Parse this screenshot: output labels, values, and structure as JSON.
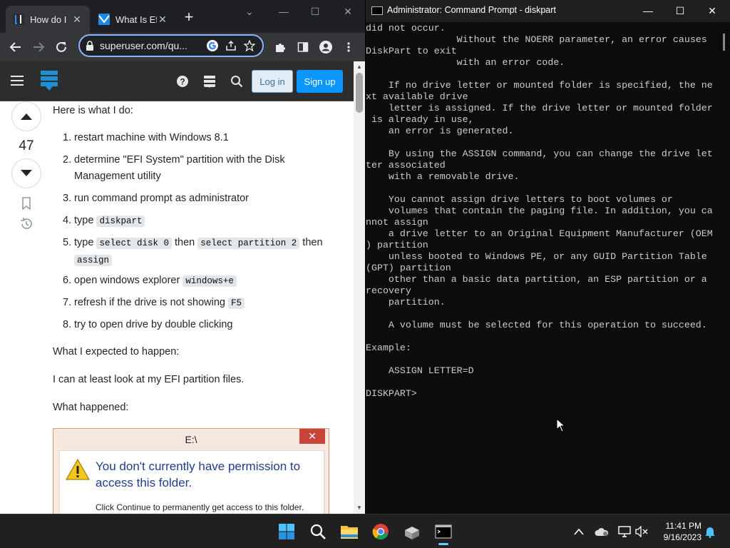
{
  "chrome": {
    "tabs": [
      {
        "title": "How do I",
        "close": "✕"
      },
      {
        "title": "What Is Ef",
        "close": "✕"
      }
    ],
    "new_tab": "+",
    "window_controls": {
      "minimize": "—",
      "maximize": "☐",
      "close": "✕"
    },
    "chevron": "⌄",
    "url": "superuser.com/qu..."
  },
  "site": {
    "login_label": "Log in",
    "signup_label": "Sign up",
    "accent_color": "#0a95ff"
  },
  "post": {
    "votes": "47",
    "intro": "Here is what I do:",
    "steps": [
      {
        "num": "1.",
        "text": "restart machine with Windows 8.1"
      },
      {
        "num": "2.",
        "line1": "determine \"EFI System\" partition with the Disk",
        "line2": "Management utility"
      },
      {
        "num": "3.",
        "text": "run command prompt as administrator"
      },
      {
        "num": "4.",
        "text": "type ",
        "code": "diskpart"
      },
      {
        "num": "5.",
        "text": "type ",
        "code1": "select disk 0",
        "then1": " then ",
        "code2": "select partition 2",
        "then2": " then",
        "code3": "assign"
      },
      {
        "num": "6.",
        "text": "open windows explorer ",
        "code": "windows+e"
      },
      {
        "num": "7.",
        "text": "refresh if the drive is not showing ",
        "code": "F5"
      },
      {
        "num": "8.",
        "text": "try to open drive by double clicking"
      }
    ],
    "expected_heading": "What I expected to happen:",
    "expected_text": "I can at least look at my EFI partition files.",
    "happened_heading": "What happened:",
    "dialog": {
      "title": "E:\\",
      "close": "✕",
      "main_line1": "You don't currently have permission to",
      "main_line2": "access this folder.",
      "sub": "Click Continue to permanently get access to this folder."
    }
  },
  "cmd": {
    "title": "Administrator: Command Prompt - diskpart",
    "window_controls": {
      "minimize": "—",
      "maximize": "☐",
      "close": "✕"
    },
    "lines": [
      "did not occur.",
      "                Without the NOERR parameter, an error causes",
      "DiskPart to exit",
      "                with an error code.",
      "",
      "    If no drive letter or mounted folder is specified, the ne",
      "xt available drive",
      "    letter is assigned. If the drive letter or mounted folder",
      " is already in use,",
      "    an error is generated.",
      "",
      "    By using the ASSIGN command, you can change the drive let",
      "ter associated",
      "    with a removable drive.",
      "",
      "    You cannot assign drive letters to boot volumes or",
      "    volumes that contain the paging file. In addition, you ca",
      "nnot assign",
      "    a drive letter to an Original Equipment Manufacturer (OEM",
      ") partition",
      "    unless booted to Windows PE, or any GUID Partition Table",
      "(GPT) partition",
      "    other than a basic data partition, an ESP partition or a",
      "recovery",
      "    partition.",
      "",
      "    A volume must be selected for this operation to succeed.",
      "",
      "Example:",
      "",
      "    ASSIGN LETTER=D",
      "",
      "DISKPART>"
    ]
  },
  "taskbar": {
    "time": "11:41 PM",
    "date": "9/16/2023",
    "apps": [
      "start-icon",
      "search-icon",
      "file-explorer-icon",
      "chrome-icon",
      "app-icon",
      "command-prompt-icon"
    ]
  }
}
